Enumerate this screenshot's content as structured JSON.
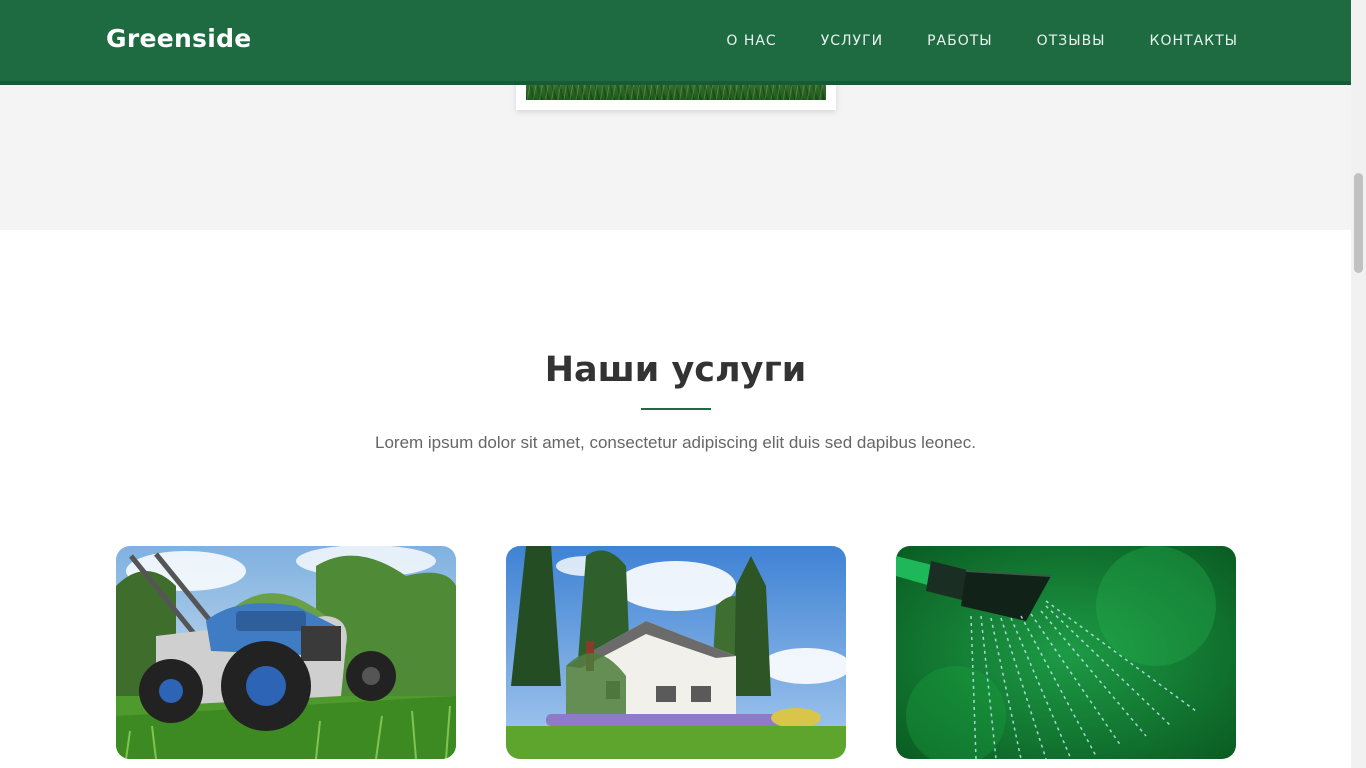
{
  "header": {
    "brand": "Greenside",
    "nav": [
      "О НАС",
      "УСЛУГИ",
      "РАБОТЫ",
      "ОТЗЫВЫ",
      "КОНТАКТЫ"
    ],
    "background_color": "#1e6b42"
  },
  "services": {
    "title": "Наши услуги",
    "subtitle": "Lorem ipsum dolor sit amet, consectetur adipiscing elit duis sed dapibus leonec.",
    "accent_color": "#1e6b42",
    "cards": [
      {
        "image": "lawn-mower-photo"
      },
      {
        "image": "house-garden-photo"
      },
      {
        "image": "watering-can-photo"
      }
    ]
  }
}
